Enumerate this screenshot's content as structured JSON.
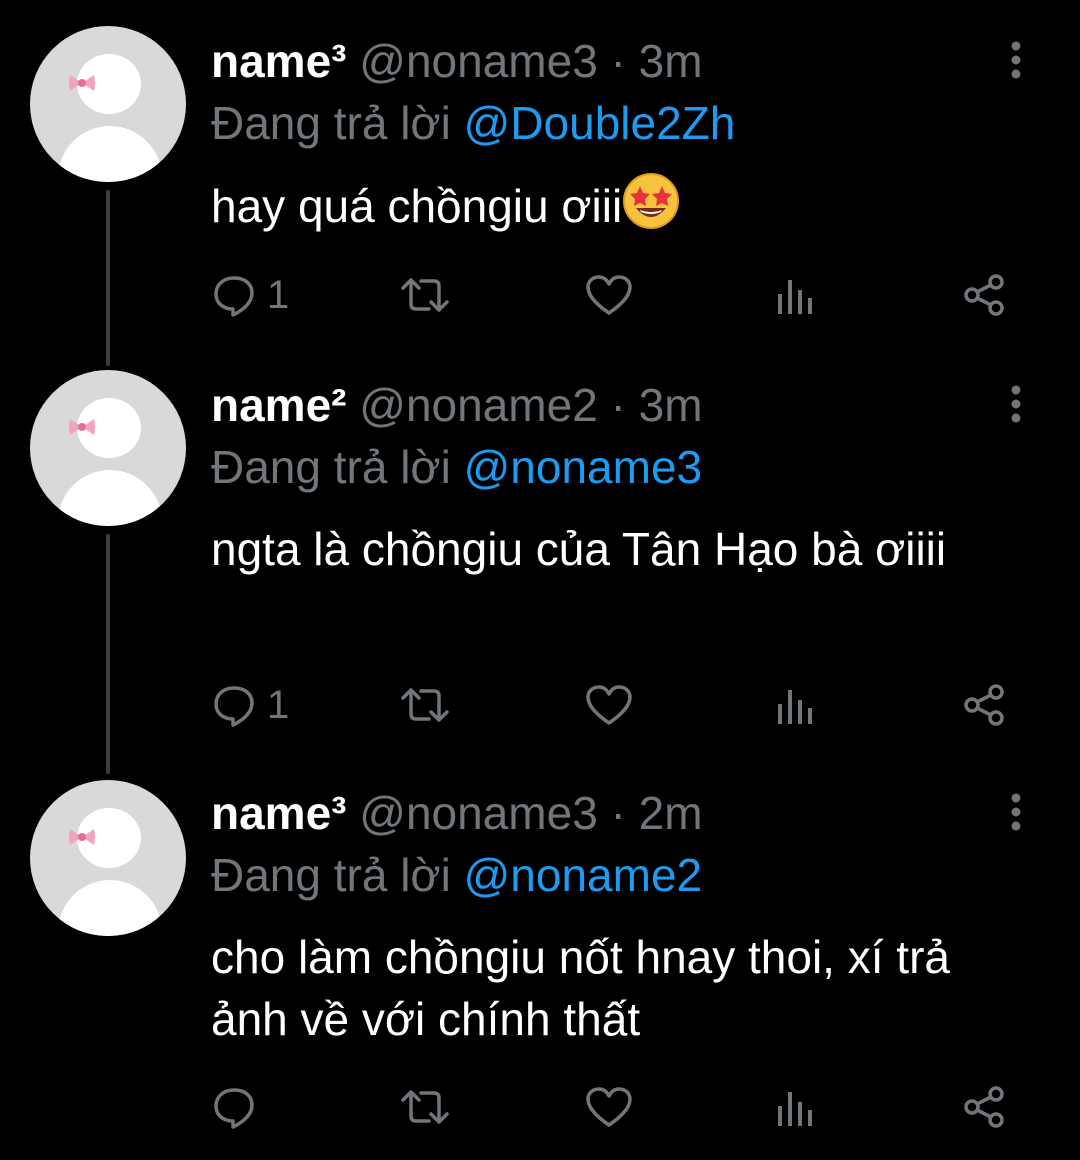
{
  "colors": {
    "accent": "#1d9bf0",
    "muted": "#71767b",
    "background": "#000000"
  },
  "tweets": [
    {
      "name": "name³",
      "handle": "@noname3",
      "sep": " · ",
      "time": "3m",
      "reply_prefix": "Đang trả lời ",
      "reply_to": "@Double2Zh",
      "text": "hay quá chồngiu ơiii",
      "emoji": "star-struck-emoji",
      "reply_count": "1"
    },
    {
      "name": "name²",
      "handle": "@noname2",
      "sep": " · ",
      "time": "3m",
      "reply_prefix": "Đang trả lời ",
      "reply_to": "@noname3",
      "text": "ngta là chồngiu của Tân Hạo bà ơiiii",
      "reply_count": "1"
    },
    {
      "name": "name³",
      "handle": "@noname3",
      "sep": " · ",
      "time": "2m",
      "reply_prefix": "Đang trả lời ",
      "reply_to": "@noname2",
      "text": "cho làm chồngiu nốt hnay thoi, xí trả ảnh về với chính thất",
      "reply_count": ""
    }
  ]
}
